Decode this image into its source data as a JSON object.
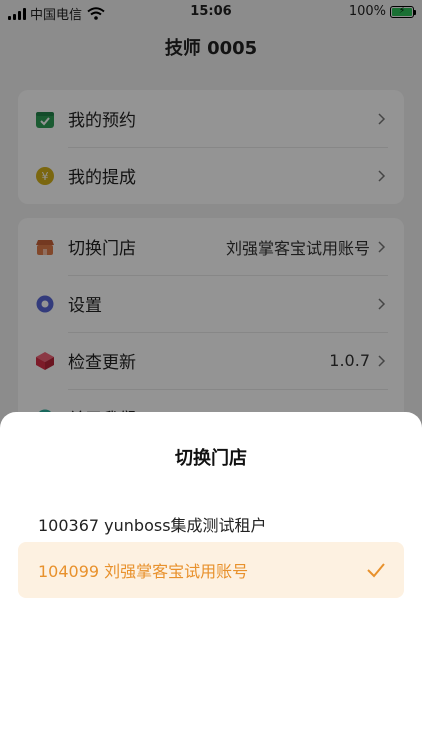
{
  "status_bar": {
    "carrier": "中国电信",
    "time": "15:06",
    "battery": "100%"
  },
  "page": {
    "title": "技师 0005"
  },
  "menu_group_1": [
    {
      "label": "我的预约",
      "icon": "calendar-icon",
      "color": "#2f9e57"
    },
    {
      "label": "我的提成",
      "icon": "yen-coin-icon",
      "color": "#d4b21a"
    }
  ],
  "menu_group_2": [
    {
      "label": "切换门店",
      "value": "刘强掌客宝试用账号",
      "icon": "store-icon",
      "color": "#e07c4a"
    },
    {
      "label": "设置",
      "value": "",
      "icon": "settings-icon",
      "color": "#5867d6"
    },
    {
      "label": "检查更新",
      "value": "1.0.7",
      "icon": "update-box-icon",
      "color": "#e23f55"
    },
    {
      "label": "关于我们",
      "value": "",
      "icon": "about-icon",
      "color": "#2db3a0"
    }
  ],
  "sheet": {
    "title": "切换门店",
    "options": [
      {
        "label": "100367 yunboss集成测试租户",
        "selected": false
      },
      {
        "label": "104099 刘强掌客宝试用账号",
        "selected": true
      }
    ],
    "accent": "#e8912c"
  }
}
